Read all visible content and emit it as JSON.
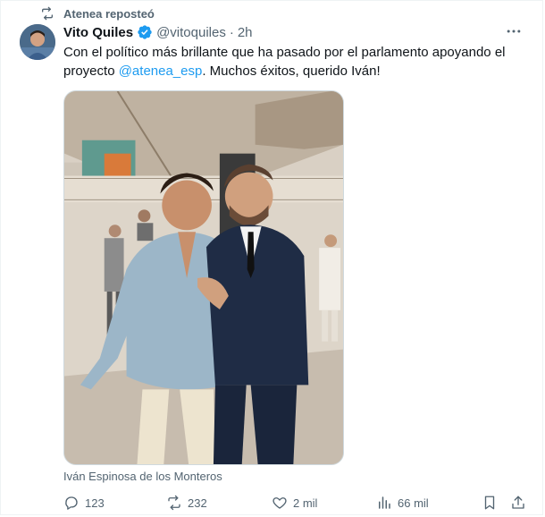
{
  "repost": {
    "label": "Atenea reposteó",
    "icon": "repost-icon"
  },
  "author": {
    "name": "Vito Quiles",
    "handle": "@vitoquiles",
    "separator": "·",
    "time": "2h",
    "verified_color": "#1d9bf0"
  },
  "tweet": {
    "text_before": "Con el político más brillante que ha pasado por el parlamento apoyando el proyecto ",
    "mention": "@atenea_esp",
    "text_after": ". Muchos éxitos, querido Iván!",
    "mention_color": "#1d9bf0"
  },
  "media": {
    "caption": "Iván Espinosa de los Monteros"
  },
  "actions": {
    "replies": "123",
    "reposts": "232",
    "likes": "2 mil",
    "views": "66 mil"
  }
}
